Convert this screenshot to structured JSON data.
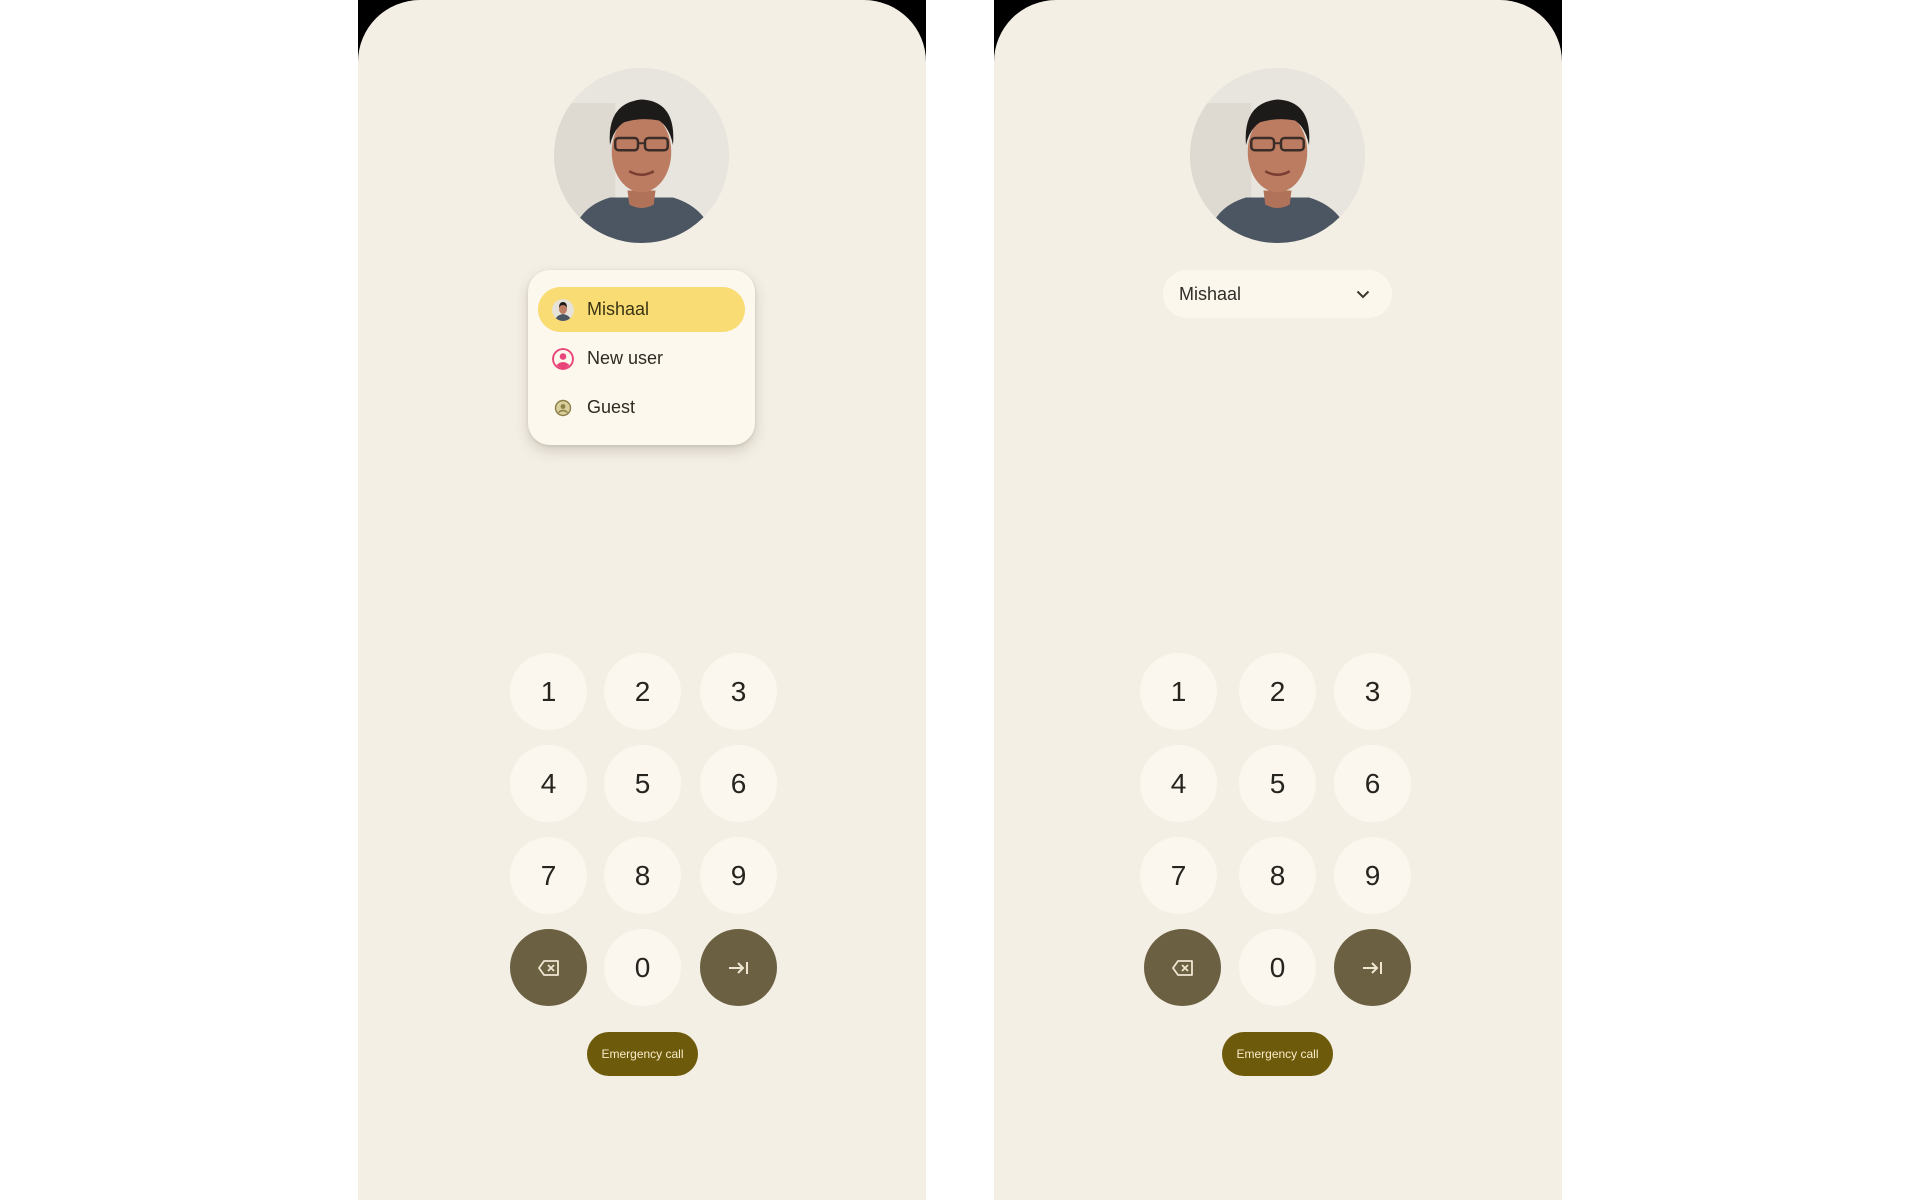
{
  "panels": [
    {
      "state": "menu-open",
      "user_menu": {
        "items": [
          {
            "label": "Mishaal",
            "icon": "user-avatar-icon",
            "selected": true
          },
          {
            "label": "New user",
            "icon": "add-user-icon",
            "selected": false
          },
          {
            "label": "Guest",
            "icon": "guest-icon",
            "selected": false
          }
        ]
      },
      "keypad": {
        "keys": [
          "1",
          "2",
          "3",
          "4",
          "5",
          "6",
          "7",
          "8",
          "9",
          "0"
        ],
        "backspace_icon": "backspace-icon",
        "enter_icon": "enter-icon"
      },
      "emergency_label": "Emergency call"
    },
    {
      "state": "menu-closed",
      "user_select": {
        "value": "Mishaal",
        "icon": "chevron-down-icon"
      },
      "keypad": {
        "keys": [
          "1",
          "2",
          "3",
          "4",
          "5",
          "6",
          "7",
          "8",
          "9",
          "0"
        ],
        "backspace_icon": "backspace-icon",
        "enter_icon": "enter-icon"
      },
      "emergency_label": "Emergency call"
    }
  ],
  "colors": {
    "background": "#f4efe5",
    "key": "#fcf7ee",
    "key_dark": "#6b6042",
    "emergency": "#6e5a0b",
    "menu_selected": "#f9dc74",
    "new_user_accent": "#e8457a"
  }
}
